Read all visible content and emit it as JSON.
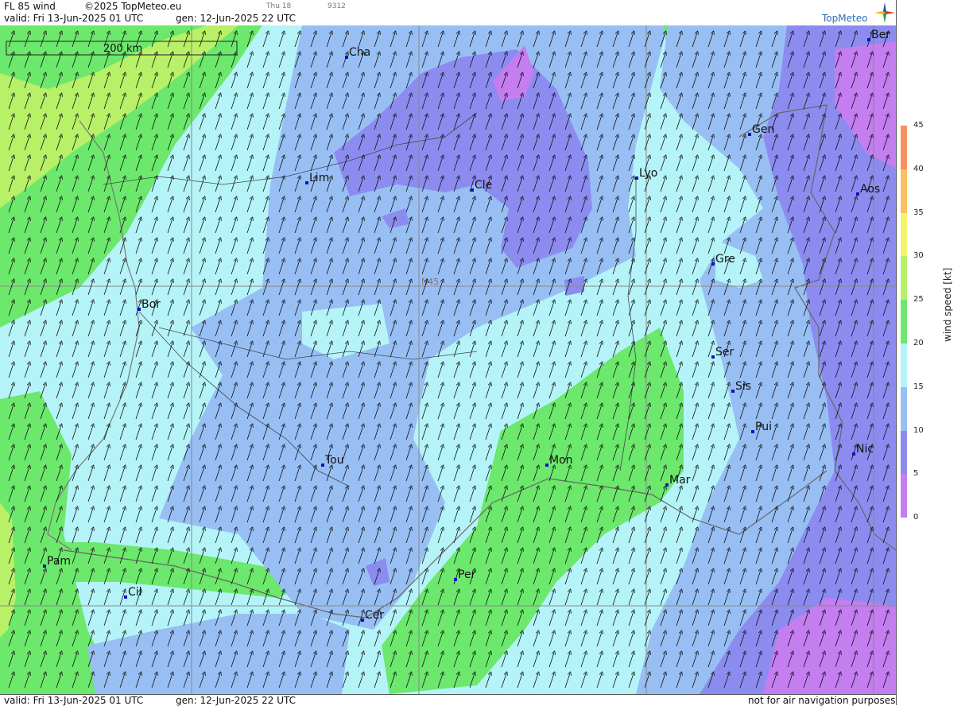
{
  "header": {
    "title": "FL 85 wind",
    "copyright": "©2025 TopMeteo.eu",
    "day_tag": "Thu 18",
    "code": "9312",
    "valid": "valid:  Fri  13-Jun-2025  01 UTC",
    "gen": "gen: 12-Jun-2025 22 UTC"
  },
  "logo": {
    "text": "TopMeteo",
    "colors": [
      "#1c5fb0",
      "#e03b2a",
      "#2e9a3a",
      "#f0b800"
    ]
  },
  "scale_bar": {
    "label": "200 km"
  },
  "grid": {
    "parallel_label": "N45"
  },
  "cities": [
    {
      "name": "Cha"
    },
    {
      "name": "Lim"
    },
    {
      "name": "Cle"
    },
    {
      "name": "Lyo"
    },
    {
      "name": "Gen"
    },
    {
      "name": "Ber"
    },
    {
      "name": "Aos"
    },
    {
      "name": "Gre"
    },
    {
      "name": "Bor"
    },
    {
      "name": "Ser"
    },
    {
      "name": "Sis"
    },
    {
      "name": "Pui"
    },
    {
      "name": "Tou"
    },
    {
      "name": "Mon"
    },
    {
      "name": "Mar"
    },
    {
      "name": "Nic"
    },
    {
      "name": "Pam"
    },
    {
      "name": "Cil"
    },
    {
      "name": "Per"
    },
    {
      "name": "Cer"
    }
  ],
  "legend": {
    "variable_label": "wind speed [kt]",
    "ticks": [
      "45",
      "40",
      "35",
      "30",
      "25",
      "20",
      "15",
      "10",
      "5",
      "0"
    ],
    "colors": {
      "0-5": "#c47ef0",
      "5-10": "#8c8cf0",
      "10-15": "#98bff4",
      "15-20": "#b4f4f8",
      "20-25": "#6ce86c",
      "25-30": "#b8f068",
      "30-35": "#f4f470",
      "35-40": "#f8c060",
      "40-45": "#f89060"
    }
  },
  "footer": {
    "valid": "valid:  Fri  13-Jun-2025  01 UTC",
    "gen": "gen: 12-Jun-2025 22 UTC",
    "disclaimer": "not for air navigation purposes"
  }
}
